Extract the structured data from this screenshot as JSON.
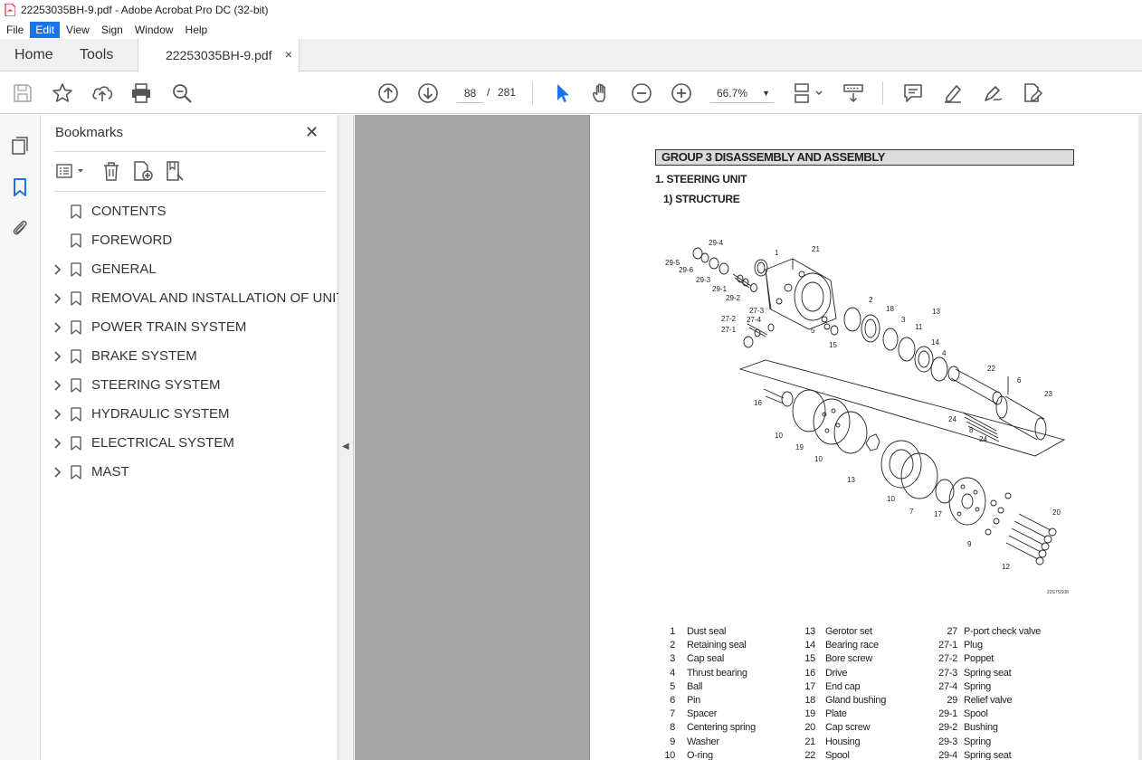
{
  "window": {
    "title": "22253035BH-9.pdf - Adobe Acrobat Pro DC (32-bit)"
  },
  "menu": [
    {
      "label": "File",
      "active": false
    },
    {
      "label": "Edit",
      "active": true
    },
    {
      "label": "View",
      "active": false
    },
    {
      "label": "Sign",
      "active": false
    },
    {
      "label": "Window",
      "active": false
    },
    {
      "label": "Help",
      "active": false
    }
  ],
  "tabs": {
    "home": "Home",
    "tools": "Tools",
    "document": "22253035BH-9.pdf",
    "close": "×"
  },
  "toolbar": {
    "current_page": "88",
    "page_separator": "/",
    "total_pages": "281",
    "zoom": "66.7%",
    "accent_color": "#1a73e8"
  },
  "bookmarks": {
    "title": "Bookmarks",
    "close": "✕",
    "items": [
      {
        "label": "CONTENTS",
        "expandable": false
      },
      {
        "label": "FOREWORD",
        "expandable": false
      },
      {
        "label": "GENERAL",
        "expandable": true
      },
      {
        "label": "REMOVAL AND INSTALLATION OF UNIT",
        "expandable": true
      },
      {
        "label": "POWER TRAIN SYSTEM",
        "expandable": true
      },
      {
        "label": "BRAKE SYSTEM",
        "expandable": true
      },
      {
        "label": "STEERING SYSTEM",
        "expandable": true
      },
      {
        "label": "HYDRAULIC SYSTEM",
        "expandable": true
      },
      {
        "label": "ELECTRICAL SYSTEM",
        "expandable": true
      },
      {
        "label": "MAST",
        "expandable": true
      }
    ]
  },
  "document": {
    "group_heading": "GROUP  3  DISASSEMBLY AND ASSEMBLY",
    "section": "1. STEERING UNIT",
    "subsection": "1) STRUCTURE",
    "figure_code": "22S7SS08",
    "callouts": [
      "1",
      "21",
      "29-4",
      "29-5",
      "29-6",
      "29-3",
      "29-1",
      "29-2",
      "2",
      "18",
      "3",
      "11",
      "14",
      "4",
      "13",
      "27-3",
      "27-4",
      "27-2",
      "27-1",
      "5",
      "15",
      "22",
      "6",
      "23",
      "24",
      "8",
      "24",
      "16",
      "10",
      "19",
      "10",
      "13",
      "10",
      "7",
      "17",
      "20",
      "9",
      "12"
    ],
    "parts_columns": [
      [
        {
          "no": "1",
          "name": "Dust seal"
        },
        {
          "no": "2",
          "name": "Retaining seal"
        },
        {
          "no": "3",
          "name": "Cap seal"
        },
        {
          "no": "4",
          "name": "Thrust bearing"
        },
        {
          "no": "5",
          "name": "Ball"
        },
        {
          "no": "6",
          "name": "Pin"
        },
        {
          "no": "7",
          "name": "Spacer"
        },
        {
          "no": "8",
          "name": "Centering spring"
        },
        {
          "no": "9",
          "name": "Washer"
        },
        {
          "no": "10",
          "name": "O-ring"
        }
      ],
      [
        {
          "no": "13",
          "name": "Gerotor set"
        },
        {
          "no": "14",
          "name": "Bearing race"
        },
        {
          "no": "15",
          "name": "Bore screw"
        },
        {
          "no": "16",
          "name": "Drive"
        },
        {
          "no": "17",
          "name": "End cap"
        },
        {
          "no": "18",
          "name": "Gland bushing"
        },
        {
          "no": "19",
          "name": "Plate"
        },
        {
          "no": "20",
          "name": "Cap screw"
        },
        {
          "no": "21",
          "name": "Housing"
        },
        {
          "no": "22",
          "name": "Spool"
        }
      ],
      [
        {
          "no": "27",
          "name": "P-port check valve"
        },
        {
          "no": "27-1",
          "name": "Plug"
        },
        {
          "no": "27-2",
          "name": "Poppet"
        },
        {
          "no": "27-3",
          "name": "Spring seat"
        },
        {
          "no": "27-4",
          "name": "Spring"
        },
        {
          "no": "29",
          "name": "Relief valve"
        },
        {
          "no": "29-1",
          "name": "Spool"
        },
        {
          "no": "29-2",
          "name": "Bushing"
        },
        {
          "no": "29-3",
          "name": "Spring"
        },
        {
          "no": "29-4",
          "name": "Spring seat"
        }
      ]
    ]
  }
}
